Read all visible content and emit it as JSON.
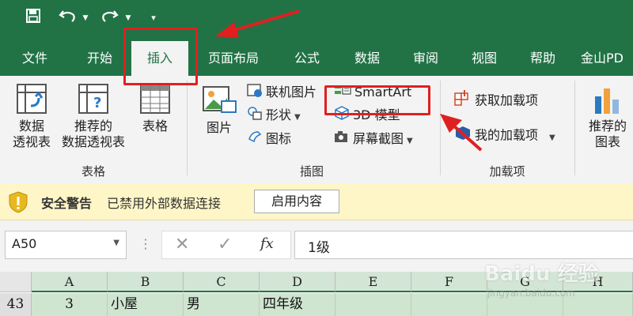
{
  "quick_access": {
    "save_icon": "save-icon",
    "undo_icon": "undo-icon",
    "redo_icon": "redo-icon",
    "customize_icon": "customize-icon"
  },
  "tabs": [
    {
      "label": "文件"
    },
    {
      "label": "开始"
    },
    {
      "label": "插入",
      "active": true
    },
    {
      "label": "页面布局"
    },
    {
      "label": "公式"
    },
    {
      "label": "数据"
    },
    {
      "label": "审阅"
    },
    {
      "label": "视图"
    },
    {
      "label": "帮助"
    },
    {
      "label": "金山PD"
    }
  ],
  "ribbon": {
    "tables_group": {
      "label": "表格",
      "pivot_line1": "数据",
      "pivot_line2": "透视表",
      "rec_pivot_line1": "推荐的",
      "rec_pivot_line2": "数据透视表",
      "table": "表格"
    },
    "illustrations_group": {
      "label": "插图",
      "pictures": "图片",
      "online_pictures": "联机图片",
      "shapes": "形状",
      "icons": "图标",
      "smartart": "SmartArt",
      "model3d": "3D 模型",
      "screenshot": "屏幕截图"
    },
    "addins_group": {
      "label": "加载项",
      "get_addins": "获取加载项",
      "my_addins": "我的加载项"
    },
    "charts_group": {
      "rec_charts_line1": "推荐的",
      "rec_charts_line2": "图表"
    }
  },
  "security_bar": {
    "title": "安全警告",
    "message": "已禁用外部数据连接",
    "button": "启用内容"
  },
  "formula_bar": {
    "name_box": "A50",
    "fx": "fx",
    "value": "1级"
  },
  "columns": [
    "A",
    "B",
    "C",
    "D",
    "E",
    "F",
    "G",
    "H"
  ],
  "row": {
    "number": "43",
    "cells": [
      "3",
      "小屋",
      "男",
      "四年级"
    ]
  },
  "watermark": {
    "text": "Baidu 经验",
    "sub": "jingyan.baidu.com"
  },
  "colors": {
    "brand": "#217346",
    "highlight": "#e02020",
    "selection": "#cfe5cf"
  }
}
